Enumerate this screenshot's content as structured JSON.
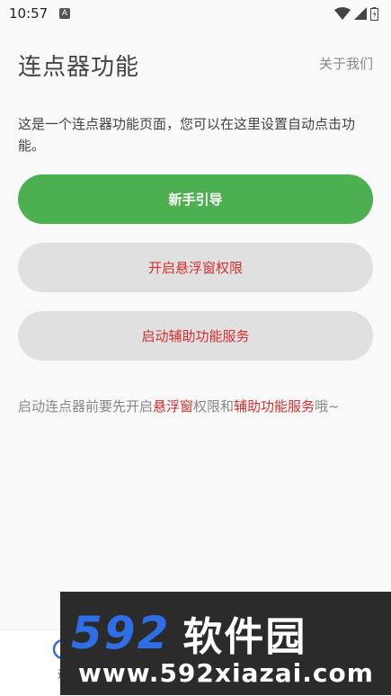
{
  "status_bar": {
    "time": "10:57",
    "notification_badge": "A",
    "icons": [
      "wifi-icon",
      "signal-icon",
      "battery-icon"
    ]
  },
  "header": {
    "title": "连点器功能",
    "about_label": "关于我们"
  },
  "description": "这是一个连点器功能页面，您可以在这里设置自动点击功能。",
  "buttons": {
    "guide": "新手引导",
    "float_permission": "开启悬浮窗权限",
    "accessibility": "启动辅助功能服务"
  },
  "hint": {
    "prefix": "启动连点器前要先开启",
    "highlight_1": "悬浮窗",
    "middle": "权限和",
    "highlight_2": "辅助功能服务",
    "suffix": "哦~"
  },
  "bottom_nav": {
    "item_label": "连"
  },
  "watermark": {
    "number": "592",
    "text": "软件园",
    "url": "www.592xiazai.com"
  },
  "colors": {
    "primary_green": "#4caf50",
    "accent_red": "#d32f2f",
    "button_gray": "#e0e0e0",
    "watermark_blue": "#2f6ee6"
  }
}
